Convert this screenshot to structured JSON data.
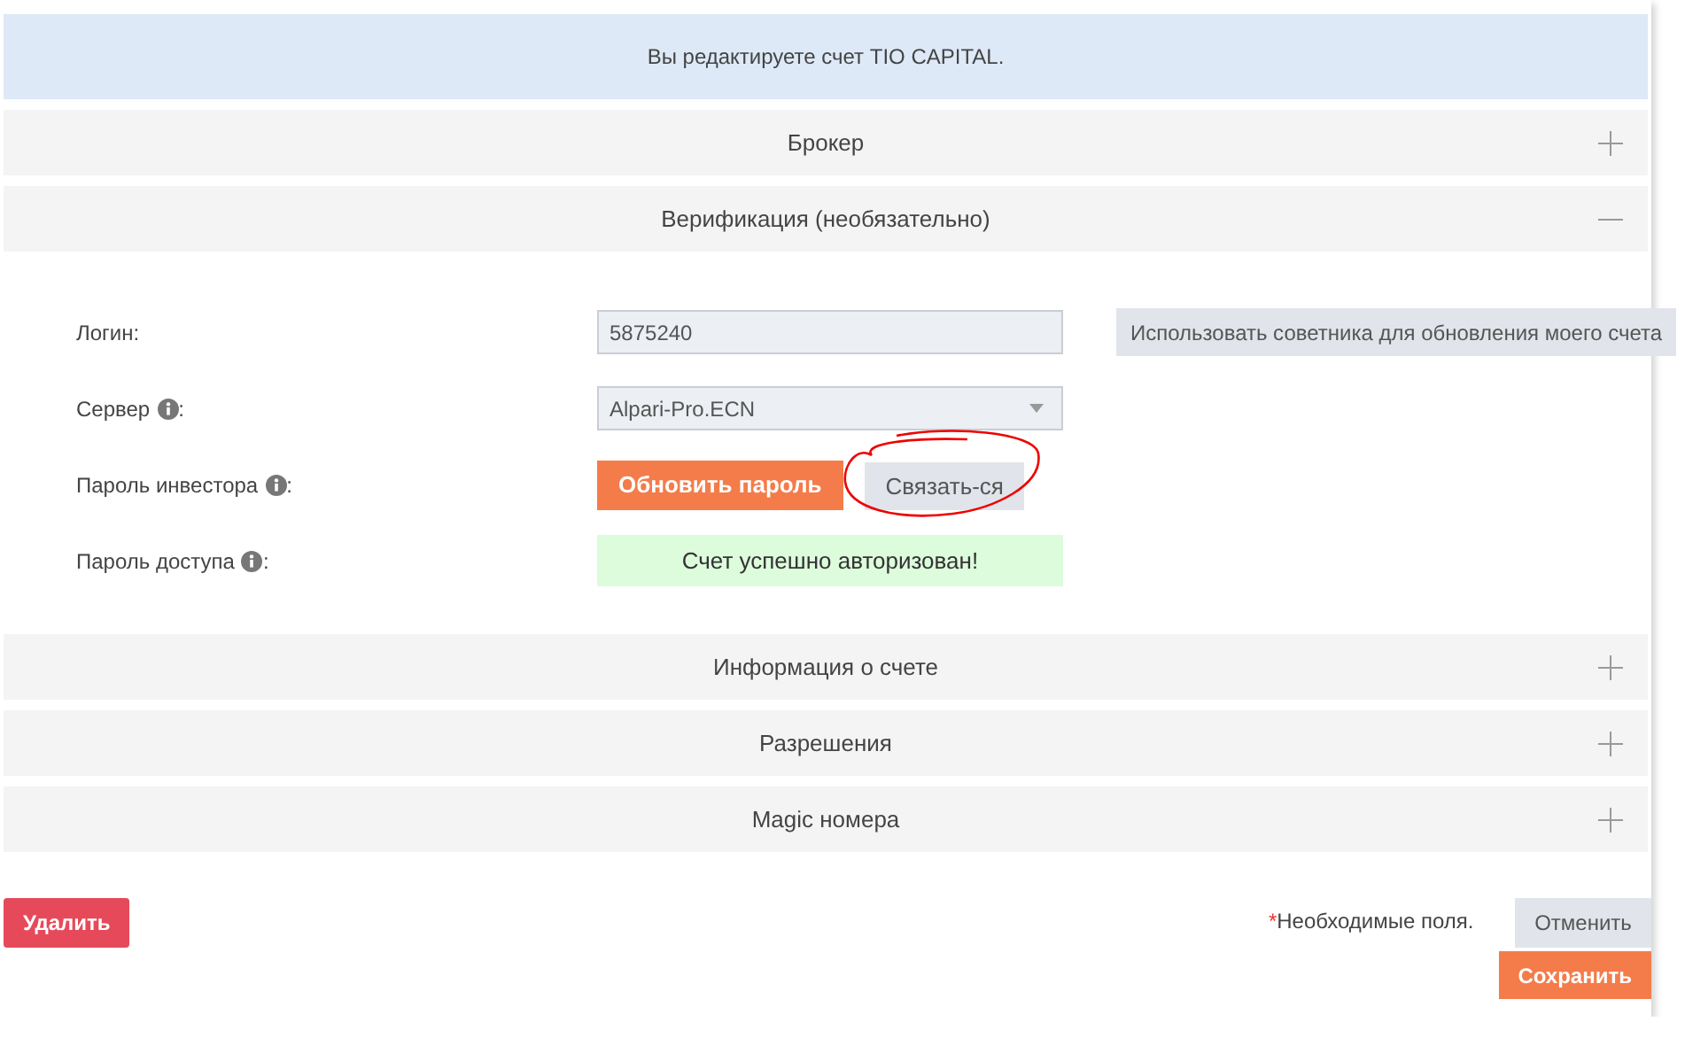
{
  "banner": "Вы редактируете счет TIO CAPITAL.",
  "sections": [
    {
      "title": "Брокер",
      "expanded": false
    },
    {
      "title": "Верификация (необязательно)",
      "expanded": true,
      "fields": [
        {
          "label": "Логин:",
          "info": false,
          "kind": "input",
          "value": "5875240",
          "side_button": "Использовать советника для обновления моего счета"
        },
        {
          "label": "Сервер",
          "colon": ":",
          "info": true,
          "kind": "select",
          "value": "Alpari-Pro.ECN"
        },
        {
          "label": "Пароль инвестора",
          "colon": ":",
          "info": true,
          "kind": "buttons",
          "buttons": [
            {
              "label": "Обновить пароль",
              "kind": "primary",
              "circled": false
            },
            {
              "label": "Связать-ся",
              "kind": "secondary",
              "circled": true
            }
          ]
        },
        {
          "label": "Пароль доступа",
          "colon": ":",
          "info": true,
          "kind": "status",
          "value": "Счет успешно авторизован!"
        }
      ]
    },
    {
      "title": "Информация о счете",
      "expanded": false
    },
    {
      "title": "Разрешения",
      "expanded": false
    },
    {
      "title": "Magic номера",
      "expanded": false
    }
  ],
  "actions": {
    "delete": "Удалить",
    "required_mark": "*",
    "required_note": "Необходимые поля.",
    "cancel": "Отменить",
    "save": "Сохранить"
  }
}
